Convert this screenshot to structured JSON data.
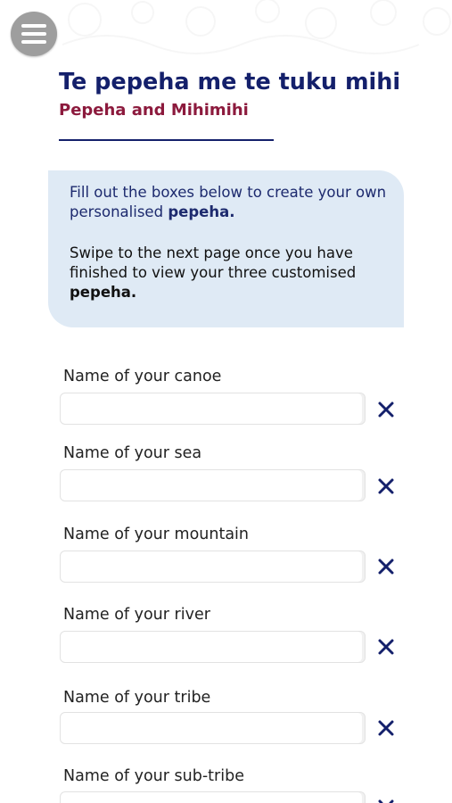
{
  "header": {
    "title": "Te pepeha me te tuku mihi",
    "subtitle": "Pepeha and Mihimihi",
    "menu_icon": "hamburger-menu-icon"
  },
  "info": {
    "line1_text": "Fill out the boxes below to create your own personalised ",
    "line1_bold": "pepeha.",
    "line2_text": "Swipe to the next page once you have finished to view your three customised ",
    "line2_bold": "pepeha."
  },
  "fields": [
    {
      "label": "Name of your canoe",
      "value": "",
      "placeholder": "",
      "clear_icon": "close-icon"
    },
    {
      "label": "Name of your sea",
      "value": "",
      "placeholder": "",
      "clear_icon": "close-icon"
    },
    {
      "label": "Name of your mountain",
      "value": "",
      "placeholder": "",
      "clear_icon": "close-icon"
    },
    {
      "label": "Name of your river",
      "value": "",
      "placeholder": "",
      "clear_icon": "close-icon"
    },
    {
      "label": "Name of your tribe",
      "value": "",
      "placeholder": "",
      "clear_icon": "close-icon"
    },
    {
      "label": "Name of your sub-tribe",
      "value": "",
      "placeholder": "",
      "clear_icon": "close-icon"
    }
  ],
  "colors": {
    "title": "#14206b",
    "subtitle": "#8c1a3d",
    "info_background": "#dfeaf5",
    "clear_icon": "#14206b",
    "menu_button": "#9e9e9e"
  }
}
